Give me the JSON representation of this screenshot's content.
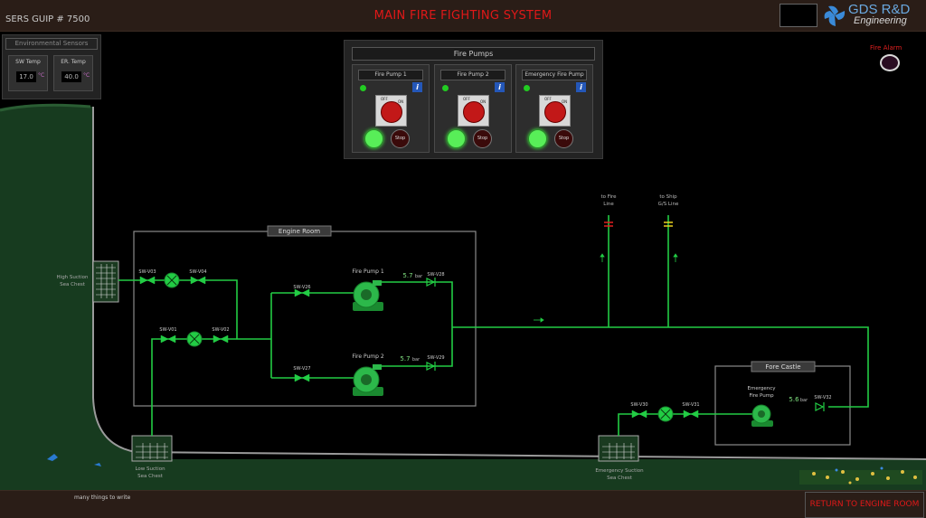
{
  "header": {
    "code": "SERS GUIP # 7500",
    "title": "MAIN FIRE FIGHTING SYSTEM",
    "logo_top": "GDS R&D",
    "logo_bottom": "Engineering"
  },
  "env_sensors": {
    "title": "Environmental Sensors",
    "sw_temp": {
      "label": "SW Temp",
      "value": "17.0",
      "unit": "°C"
    },
    "er_temp": {
      "label": "ER. Temp",
      "value": "40.0",
      "unit": "°C"
    }
  },
  "fire_pumps_panel": {
    "title": "Fire Pumps",
    "pumps": [
      {
        "name": "Fire Pump 1",
        "info": "i",
        "off": "OFF",
        "on": "ON",
        "stop": "Stop"
      },
      {
        "name": "Fire Pump 2",
        "info": "i",
        "off": "OFF",
        "on": "ON",
        "stop": "Stop"
      },
      {
        "name": "Emergency Fire Pump",
        "info": "i",
        "off": "OFF",
        "on": "ON",
        "stop": "Stop"
      }
    ]
  },
  "fire_alarm": {
    "label": "Fire Alarm"
  },
  "diagram": {
    "engine_room": "Engine Room",
    "fore_castle": "Fore Castle",
    "high_suction": [
      "High Suction",
      "Sea Chest"
    ],
    "low_suction": [
      "Low Suction",
      "Sea Chest"
    ],
    "emergency_suction": [
      "Emergency Suction",
      "Sea Chest"
    ],
    "to_fire_line": [
      "to Fire",
      "Line"
    ],
    "to_ship_gs": [
      "to Ship",
      "G/S Line"
    ],
    "valves": {
      "v03": "SW-V03",
      "v04": "SW-V04",
      "v01": "SW-V01",
      "v02": "SW-V02",
      "v26": "SW-V26",
      "v27": "SW-V27",
      "v28": "SW-V28",
      "v29": "SW-V29",
      "v30": "SW-V30",
      "v31": "SW-V31",
      "v32": "SW-V32"
    },
    "pump1": {
      "label": "Fire Pump 1",
      "pressure": "5.7",
      "unit": "bar"
    },
    "pump2": {
      "label": "Fire Pump 2",
      "pressure": "5.7",
      "unit": "bar"
    },
    "emergency_pump": {
      "label": [
        "Emergency",
        "Fire Pump"
      ],
      "pressure": "5.6",
      "unit": "bar"
    }
  },
  "footer": {
    "note": "many things to write",
    "return_button": "RETURN TO ENGINE ROOM"
  }
}
